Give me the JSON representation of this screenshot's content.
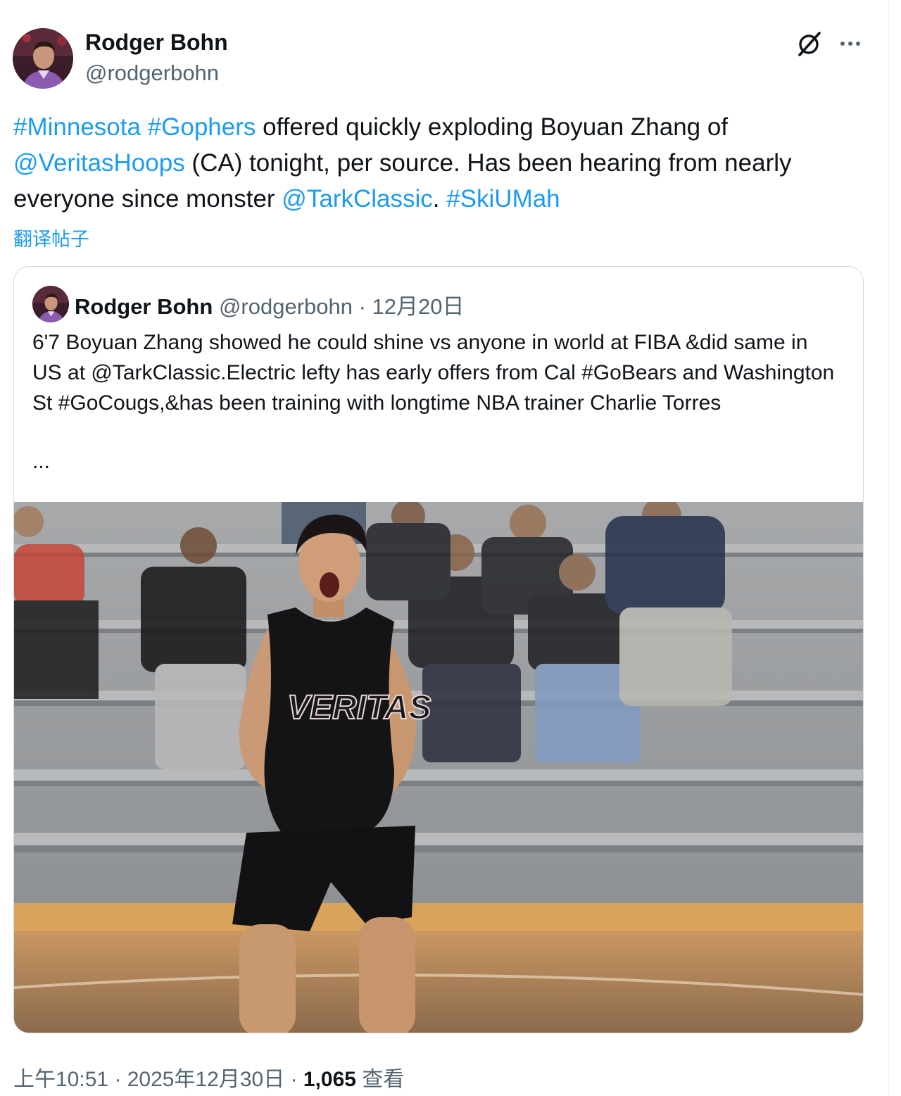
{
  "author": {
    "name": "Rodger Bohn",
    "handle": "@rodgerbohn"
  },
  "tweet": {
    "segments": [
      {
        "text": "#Minnesota",
        "link": true
      },
      {
        "text": " ",
        "link": false
      },
      {
        "text": "#Gophers",
        "link": true
      },
      {
        "text": " offered quickly exploding Boyuan Zhang of ",
        "link": false
      },
      {
        "text": "@VeritasHoops",
        "link": true
      },
      {
        "text": " (CA) tonight, per source. Has been hearing from nearly everyone since monster ",
        "link": false
      },
      {
        "text": "@TarkClassic",
        "link": true
      },
      {
        "text": ". ",
        "link": false
      },
      {
        "text": "#SkiUMah",
        "link": true
      }
    ],
    "translate_label": "翻译帖子"
  },
  "quote": {
    "name": "Rodger Bohn",
    "handle": "@rodgerbohn",
    "separator": " · ",
    "date": "12月20日",
    "text": "6'7 Boyuan Zhang showed he could shine vs anyone in world at FIBA &did same in US at @TarkClassic.Electric lefty has early offers from Cal #GoBears and Washington St #GoCougs,&has been training with longtime NBA trainer Charlie Torres",
    "ellipsis": "...",
    "photo_jersey_text": "VERITAS"
  },
  "footer": {
    "time": "上午10:51",
    "separator": " · ",
    "date": "2025年12月30日",
    "views_count": "1,065",
    "views_label": " 查看"
  },
  "colors": {
    "link": "#1d9bf0",
    "text_primary": "#0f1419",
    "text_secondary": "#536471",
    "border": "#cfd9de"
  },
  "icons": {
    "grok": "grok-icon",
    "more": "more-icon"
  }
}
